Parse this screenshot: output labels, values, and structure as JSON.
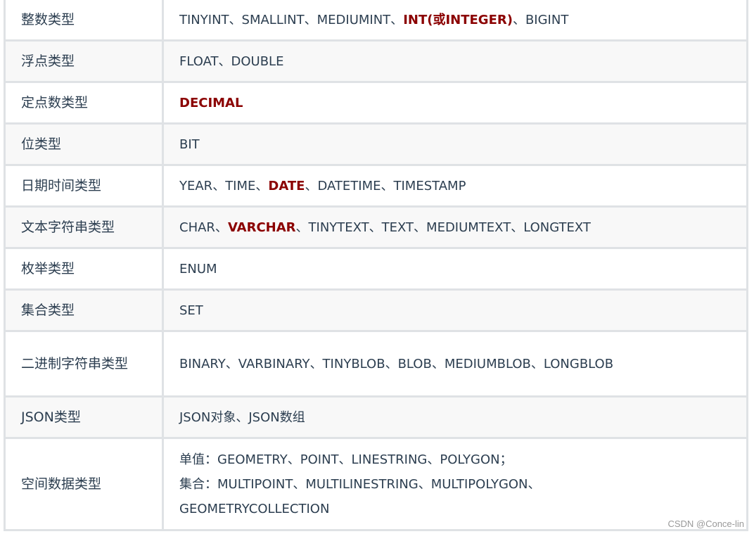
{
  "rows": [
    {
      "type": "整数类型",
      "lines": [
        [
          {
            "t": "TINYINT、SMALLINT、MEDIUMINT、"
          },
          {
            "t": "INT(或INTEGER)",
            "hl": true
          },
          {
            "t": "、BIGINT"
          }
        ]
      ]
    },
    {
      "type": "浮点类型",
      "lines": [
        [
          {
            "t": "FLOAT、DOUBLE"
          }
        ]
      ]
    },
    {
      "type": "定点数类型",
      "lines": [
        [
          {
            "t": "DECIMAL",
            "hl": true
          }
        ]
      ]
    },
    {
      "type": "位类型",
      "lines": [
        [
          {
            "t": "BIT"
          }
        ]
      ]
    },
    {
      "type": "日期时间类型",
      "lines": [
        [
          {
            "t": "YEAR、TIME、"
          },
          {
            "t": "DATE",
            "hl": true
          },
          {
            "t": "、DATETIME、TIMESTAMP"
          }
        ]
      ]
    },
    {
      "type": "文本字符串类型",
      "lines": [
        [
          {
            "t": "CHAR、"
          },
          {
            "t": "VARCHAR",
            "hl": true
          },
          {
            "t": "、TINYTEXT、TEXT、MEDIUMTEXT、LONGTEXT"
          }
        ]
      ]
    },
    {
      "type": "枚举类型",
      "lines": [
        [
          {
            "t": "ENUM"
          }
        ]
      ]
    },
    {
      "type": "集合类型",
      "lines": [
        [
          {
            "t": "SET"
          }
        ]
      ]
    },
    {
      "type": "二进制字符串类型",
      "lines": [
        [
          {
            "t": "BINARY、VARBINARY、TINYBLOB、BLOB、MEDIUMBLOB、LONGBLOB"
          }
        ]
      ]
    },
    {
      "type": "JSON类型",
      "lines": [
        [
          {
            "t": "JSON对象、JSON数组"
          }
        ]
      ]
    },
    {
      "type": "空间数据类型",
      "lines": [
        [
          {
            "t": "单值：GEOMETRY、POINT、LINESTRING、POLYGON；"
          }
        ],
        [
          {
            "t": "集合：MULTIPOINT、MULTILINESTRING、MULTIPOLYGON、"
          }
        ],
        [
          {
            "t": "GEOMETRYCOLLECTION"
          }
        ]
      ]
    }
  ],
  "highlight_color": "#8b0000",
  "watermark": "CSDN @Conce-lin"
}
